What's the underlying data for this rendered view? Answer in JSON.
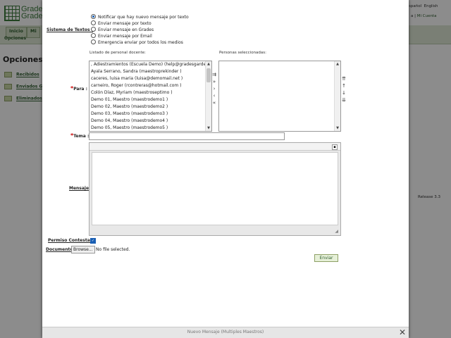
{
  "background": {
    "logo_text_line1": "Grade",
    "logo_text_line2": "Grade",
    "nav_tabs": [
      "Inicio",
      "Mi"
    ],
    "subnav": "Opciones",
    "page_heading": "Opciones",
    "folders": [
      "Recibidos",
      "Enviados G",
      "Eliminados"
    ],
    "lang_links": [
      "spañol",
      "English"
    ],
    "user_links": [
      "a",
      "Mi Cuenta"
    ],
    "release": "Release 3.3"
  },
  "modal": {
    "title": "Nuevo Mensaje (Multiples Maestros)",
    "sistema_label": "Sistema de Textos :",
    "radio_options": [
      "Notificar que hay nuevo mensaje por texto",
      "Enviar mensaje por texto",
      "Enviar mensaje en Grades",
      "Enviar mensaje por Email",
      "Emergencia enviar por todos los medios"
    ],
    "selected_radio": 0,
    "para_label": "Para :",
    "listado_label": "Listado de personal docente:",
    "seleccionadas_label": "Personas seleccionadas:",
    "staff": [
      ", Adiestramientos (Escuela Demo) (help@gradesgarde",
      "Ayala Serrano, Sandra (maestroprekinder )",
      "caceres, luisa maria (luisa@demomail.net )",
      "carneiro, Roger (rcontreras@hotmail.com )",
      "Colón Díaz, Myriam (maestroseptimo )",
      "Demo 01, Maestro (maestrodemo1 )",
      "Demo 02, Maestro (maestrodemo2 )",
      "Demo 03, Maestro (maestrodemo3 )",
      "Demo 04, Maestro (maestrodemo4 )",
      "Demo 05, Maestro (maestrodemo5 )"
    ],
    "tema_label": "Tema :",
    "tema_value": "",
    "mensaje_label": "Mensaje",
    "permiso_label": "Permiso Contestar",
    "documento_label": "Documento",
    "browse_label": "Browse...",
    "no_file": "No file selected.",
    "enviar_label": "Enviar",
    "close_symbol": "✕"
  }
}
